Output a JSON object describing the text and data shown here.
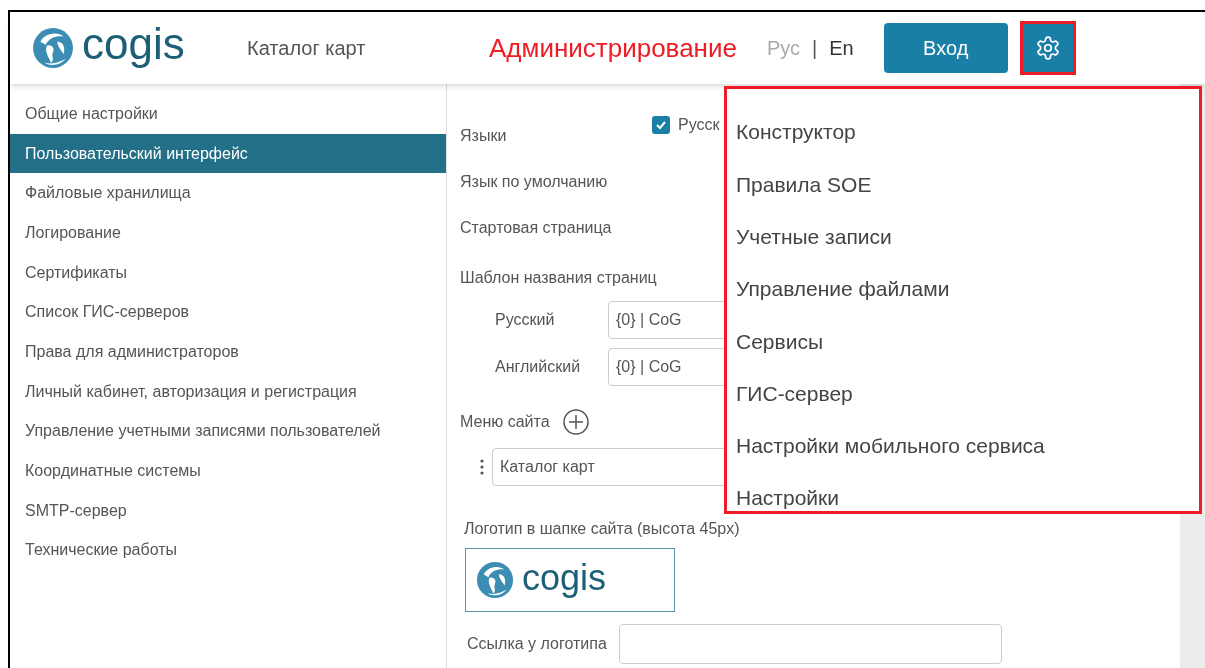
{
  "header": {
    "logo_text": "cogis",
    "nav_link": "Каталог карт",
    "title": "Администрирование",
    "languages": [
      {
        "label": "Рус",
        "selected": true
      },
      {
        "label": "En",
        "selected": false
      }
    ],
    "separator": "|",
    "login_button": "Вход"
  },
  "sidebar": {
    "items": [
      {
        "label": "Общие настройки",
        "selected": false
      },
      {
        "label": "Пользовательский интерфейс",
        "selected": true
      },
      {
        "label": "Файловые хранилища",
        "selected": false
      },
      {
        "label": "Логирование",
        "selected": false
      },
      {
        "label": "Сертификаты",
        "selected": false
      },
      {
        "label": "Список ГИС-серверов",
        "selected": false
      },
      {
        "label": "Права для администраторов",
        "selected": false
      },
      {
        "label": "Личный кабинет, авторизация и регистрация",
        "selected": false
      },
      {
        "label": "Управление учетными записями пользователей",
        "selected": false
      },
      {
        "label": "Координатные системы",
        "selected": false
      },
      {
        "label": "SMTP-сервер",
        "selected": false
      },
      {
        "label": "Технические работы",
        "selected": false
      }
    ]
  },
  "form": {
    "languages_label": "Языки",
    "language_option": {
      "label": "Русск",
      "checked": true
    },
    "default_language_label": "Язык по умолчанию",
    "start_page_label": "Стартовая страница",
    "title_template_label": "Шаблон названия страниц",
    "title_templates": [
      {
        "label": "Русский",
        "value": "{0} | CoG"
      },
      {
        "label": "Английский",
        "value": "{0} | CoG"
      }
    ],
    "site_menu_label": "Меню сайта",
    "site_menu_items": [
      "Каталог карт"
    ],
    "logo_label": "Логотип в шапке сайта (высота 45px)",
    "logo_preview_text": "cogis",
    "logo_link_label": "Ссылка у логотипа"
  },
  "settings_menu": {
    "items": [
      "Конструктор",
      "Правила SOE",
      "Учетные записи",
      "Управление файлами",
      "Сервисы",
      "ГИС-сервер",
      "Настройки мобильного сервиса",
      "Настройки"
    ]
  }
}
